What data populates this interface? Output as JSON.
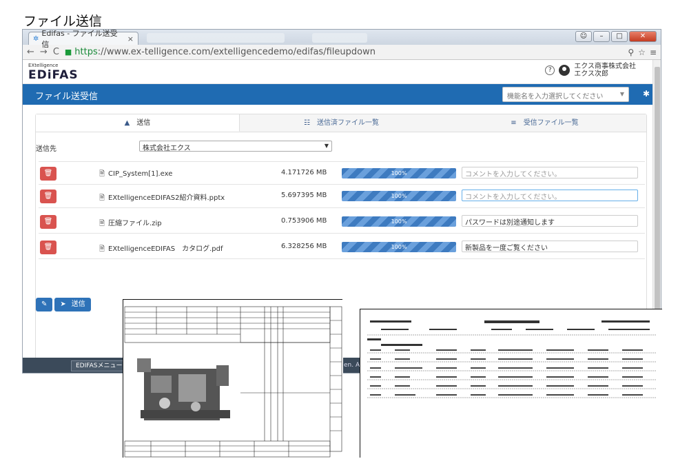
{
  "page_heading": "ファイル送信",
  "browser": {
    "tab_title": "Edifas - ファイル送受信",
    "tab_close": "×",
    "url_https": "https",
    "url_rest": "://www.ex-telligence.com/extelligencedemo/edifas/fileupdown"
  },
  "header": {
    "logo_small": "EXtelligence",
    "logo_big": "EDiFAS",
    "help": "?",
    "company": "エクス商事株式会社",
    "user": "エクス次郎"
  },
  "nav": {
    "title": "ファイル送受信",
    "function_placeholder": "機能名を入力選択してください"
  },
  "tabs": [
    {
      "label": "送信",
      "icon": "▲"
    },
    {
      "label": "送信済ファイル一覧",
      "icon": "☷"
    },
    {
      "label": "受信ファイル一覧",
      "icon": "≡"
    }
  ],
  "destination": {
    "label": "送信先",
    "value": "株式会社エクス"
  },
  "files": [
    {
      "name": "CIP_System[1].exe",
      "size": "4.171726 MB",
      "progress": "100%",
      "progress_value": 100,
      "comment": "コメントを入力してください。",
      "placeholder": true
    },
    {
      "name": "EXtelligenceEDIFAS2紹介資料.pptx",
      "size": "5.697395 MB",
      "progress": "100%",
      "progress_value": 100,
      "comment": "コメントを入力してください。",
      "placeholder": true
    },
    {
      "name": "圧縮ファイル.zip",
      "size": "0.753906 MB",
      "progress": "100%",
      "progress_value": 100,
      "comment": "パスワードは別途通知します",
      "placeholder": false
    },
    {
      "name": "EXtelligenceEDIFAS　カタログ.pdf",
      "size": "6.328256 MB",
      "progress": "100%",
      "progress_value": 100,
      "comment": "新製品を一度ご覧ください",
      "placeholder": false
    }
  ],
  "actions": {
    "attach_icon": "paperclip-icon",
    "send_label": "送信"
  },
  "footer": {
    "menu_label": "EDIFASメニューへ",
    "copyright": "en. All"
  },
  "icons": {
    "delete": "trash-icon",
    "file": "document-icon",
    "gear": "gear-icon"
  },
  "colors": {
    "brand_blue": "#1f6bb2",
    "danger": "#d9534f",
    "progress": "#3e7bc0"
  }
}
